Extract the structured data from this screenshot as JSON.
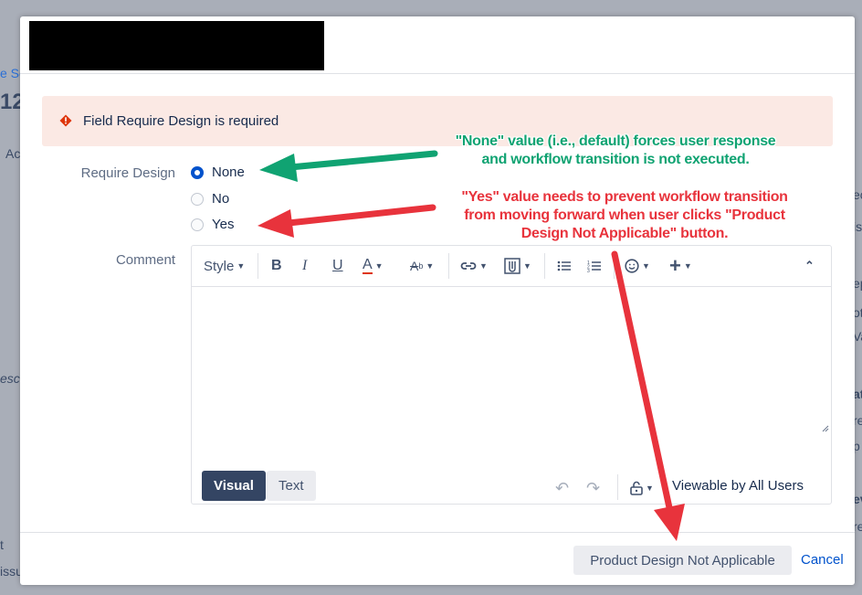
{
  "background": {
    "fragments": [
      "e Sc",
      "12",
      "Ac",
      "esc",
      "ec",
      "iss",
      "ep",
      "ot",
      "Va",
      "at",
      "re",
      "p",
      "ev",
      "re",
      "t",
      "issu"
    ]
  },
  "dialog": {
    "error": {
      "icon": "error-icon",
      "text": "Field Require Design is required",
      "color": "#de350b"
    },
    "require_design": {
      "label": "Require Design",
      "options": [
        {
          "label": "None",
          "checked": true
        },
        {
          "label": "No",
          "checked": false
        },
        {
          "label": "Yes",
          "checked": false
        }
      ]
    },
    "comment": {
      "label": "Comment",
      "toolbar": {
        "style_label": "Style",
        "icons": [
          "bold-icon",
          "italic-icon",
          "underline-icon",
          "text-color-icon",
          "text-effects-icon",
          "link-icon",
          "attachment-icon",
          "bullet-list-icon",
          "numbered-list-icon",
          "emoji-icon",
          "insert-more-icon",
          "collapse-toolbar-icon"
        ]
      },
      "modes": {
        "visual": "Visual",
        "text": "Text"
      },
      "viewable": "Viewable by All Users"
    },
    "footer": {
      "primary_button": "Product Design Not Applicable",
      "cancel": "Cancel"
    }
  },
  "annotations": {
    "green_note": [
      "\"None\" value (i.e., default) forces user response",
      "and workflow transition is not executed."
    ],
    "red_note": [
      "\"Yes\" value needs to prevent workflow transition",
      "from moving forward when user clicks \"Product",
      "Design Not Applicable\" button."
    ],
    "colors": {
      "green": "#10a372",
      "red": "#e8333c"
    }
  }
}
